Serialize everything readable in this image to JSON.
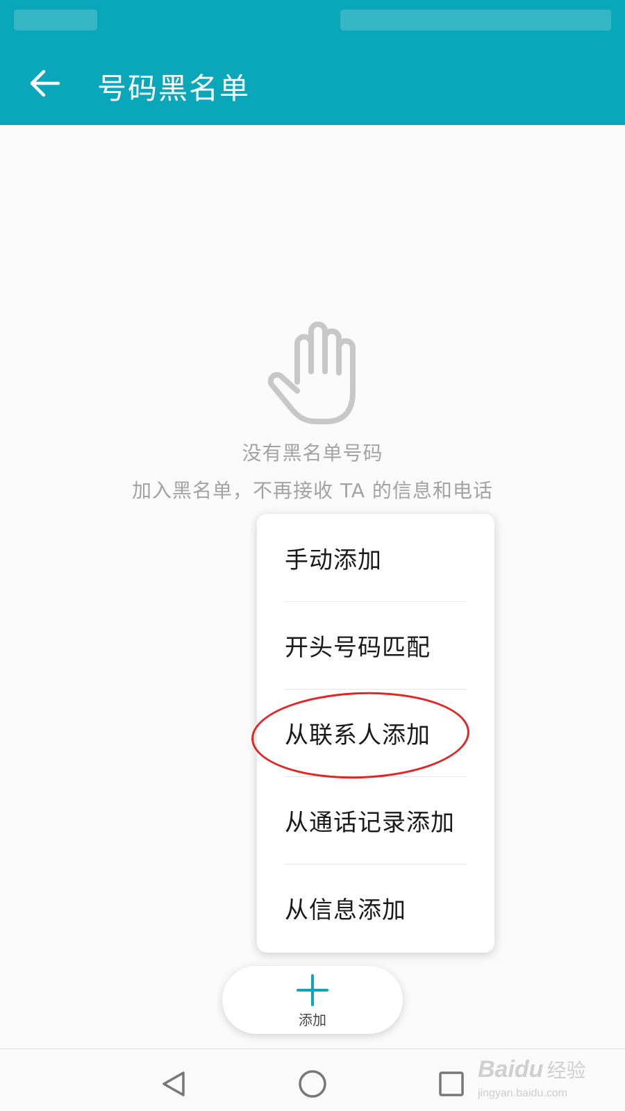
{
  "header": {
    "title": "号码黑名单",
    "back_icon": "arrow-left-icon",
    "background_color": "#0aa6b9"
  },
  "empty_state": {
    "icon": "raised-hand-icon",
    "title": "没有黑名单号码",
    "subtitle": "加入黑名单，不再接收 TA 的信息和电话"
  },
  "add_menu": {
    "items": [
      {
        "label": "手动添加"
      },
      {
        "label": "开头号码匹配"
      },
      {
        "label": "从联系人添加",
        "highlighted": true
      },
      {
        "label": "从通话记录添加"
      },
      {
        "label": "从信息添加"
      }
    ],
    "highlight_color": "#e52323"
  },
  "fab": {
    "icon": "plus-icon",
    "label": "添加",
    "accent_color": "#0aa6b9"
  },
  "navbar": {
    "back_icon": "triangle-back-icon",
    "home_icon": "circle-home-icon",
    "recent_icon": "square-recent-icon"
  },
  "watermark": {
    "logo": "Baidu",
    "text": "经验",
    "url": "jingyan.baidu.com"
  }
}
